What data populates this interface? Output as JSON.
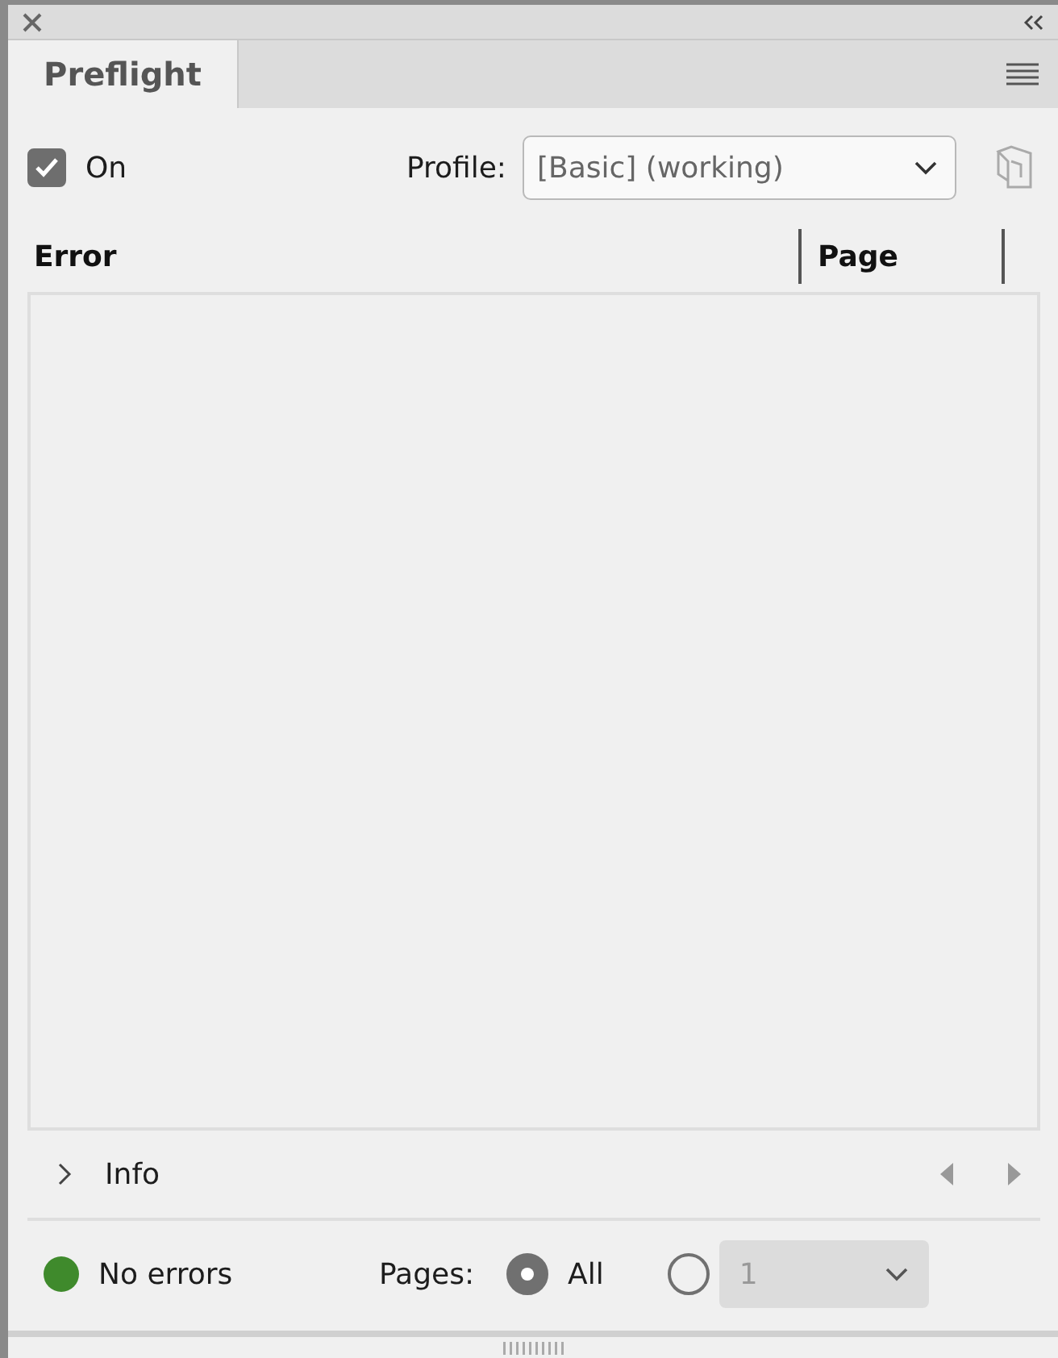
{
  "tabs": [
    {
      "label": "Preflight",
      "selected": true
    }
  ],
  "on": {
    "label": "On",
    "checked": true
  },
  "profile": {
    "label": "Profile:",
    "value": "[Basic] (working)"
  },
  "columns": [
    "Error",
    "Page"
  ],
  "info": {
    "label": "Info",
    "expanded": false
  },
  "status": {
    "label": "No errors",
    "color": "#3f8a2c"
  },
  "pages": {
    "label": "Pages:",
    "options": [
      {
        "kind": "label",
        "label": "All",
        "selected": true
      },
      {
        "kind": "dropdown",
        "value": "1",
        "selected": false
      }
    ]
  }
}
